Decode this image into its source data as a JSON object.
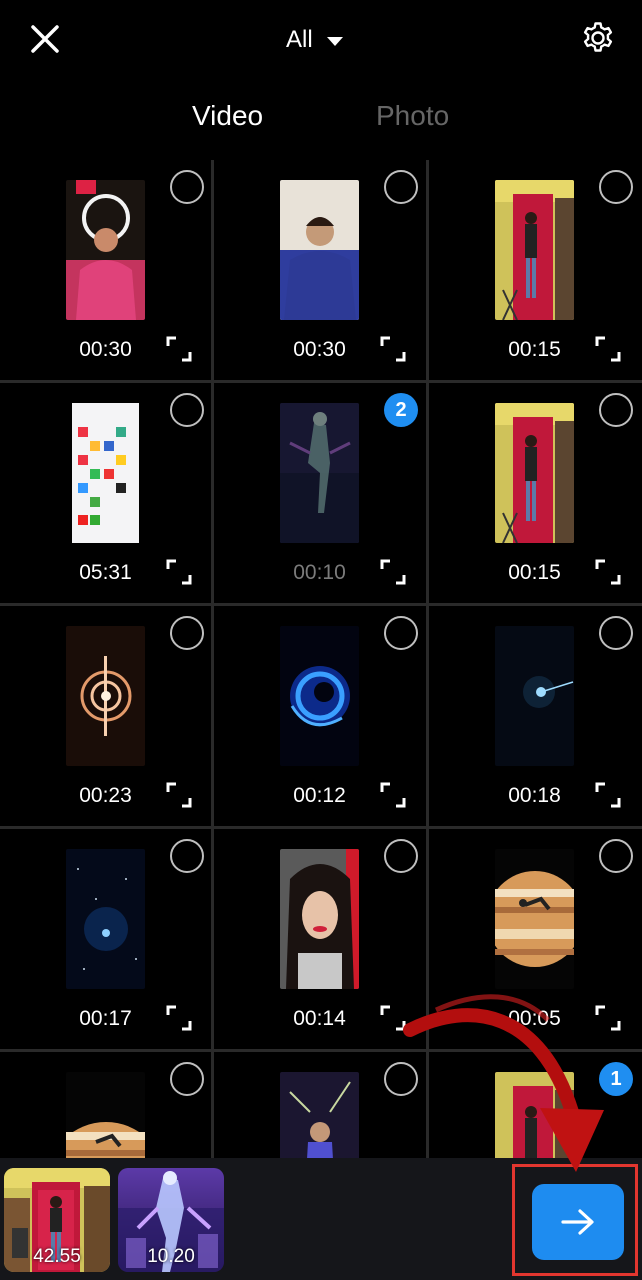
{
  "header": {
    "close_icon": "close-icon",
    "album_label": "All",
    "album_caret_icon": "caret-down-icon",
    "settings_icon": "gear-icon"
  },
  "tabs": [
    {
      "label": "Video",
      "selected": true
    },
    {
      "label": "Photo",
      "selected": false
    }
  ],
  "grid": {
    "items": [
      {
        "duration": "00:30",
        "selected_index": null,
        "thumb": "woman-pink-saree"
      },
      {
        "duration": "00:30",
        "selected_index": null,
        "thumb": "woman-blue-jacket-phone"
      },
      {
        "duration": "00:15",
        "selected_index": null,
        "thumb": "man-red-door"
      },
      {
        "duration": "05:31",
        "selected_index": null,
        "thumb": "phone-homescreen"
      },
      {
        "duration": "00:10",
        "selected_index": "2",
        "thumb": "neon-dancer"
      },
      {
        "duration": "00:15",
        "selected_index": null,
        "thumb": "man-red-door"
      },
      {
        "duration": "00:23",
        "selected_index": null,
        "thumb": "glowing-rings"
      },
      {
        "duration": "00:12",
        "selected_index": null,
        "thumb": "blue-vortex"
      },
      {
        "duration": "00:18",
        "selected_index": null,
        "thumb": "dark-space-light"
      },
      {
        "duration": "00:17",
        "selected_index": null,
        "thumb": "galaxy-stars"
      },
      {
        "duration": "00:14",
        "selected_index": null,
        "thumb": "girl-portrait"
      },
      {
        "duration": "00:05",
        "selected_index": null,
        "thumb": "jupiter-jump"
      },
      {
        "duration": "",
        "selected_index": null,
        "thumb": "jupiter-partial"
      },
      {
        "duration": "",
        "selected_index": null,
        "thumb": "boy-purple"
      },
      {
        "duration": "",
        "selected_index": "1",
        "thumb": "man-red-door-partial"
      }
    ]
  },
  "selection_tray": {
    "items": [
      {
        "time": "42.55",
        "thumb": "man-red-door"
      },
      {
        "time": "10.20",
        "thumb": "neon-dancer"
      }
    ],
    "next_icon": "arrow-right-icon"
  },
  "colors": {
    "accent": "#1e8cf0",
    "annotation_red": "#e2362f",
    "divider": "#2a2a2a",
    "inactive_tab": "#666666"
  }
}
